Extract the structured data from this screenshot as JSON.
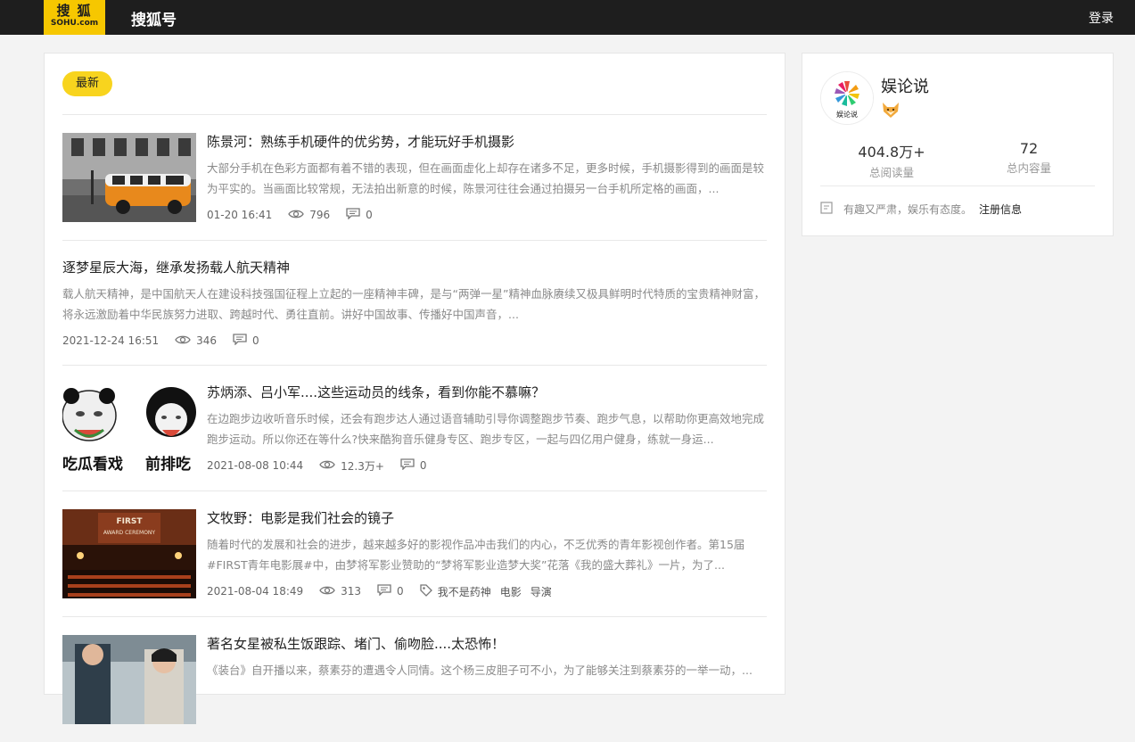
{
  "header": {
    "logo_top": "搜狐",
    "logo_bottom": "SOHU.com",
    "app_title": "搜狐号",
    "login_label": "登录"
  },
  "feed": {
    "tab_label": "最新",
    "articles": [
      {
        "title": "陈景河：熟练手机硬件的优劣势，才能玩好手机摄影",
        "summary": "大部分手机在色彩方面都有着不错的表现，但在画面虚化上却存在诸多不足，更多时候，手机摄影得到的画面是较为平实的。当画面比较常规，无法拍出新意的时候，陈景河往往会通过拍摄另一台手机所定格的画面，...",
        "time": "01-20 16:41",
        "views": "796",
        "comments": "0",
        "tags": []
      },
      {
        "title": "逐梦星辰大海，继承发扬载人航天精神",
        "summary": "载人航天精神，是中国航天人在建设科技强国征程上立起的一座精神丰碑，是与“两弹一星”精神血脉赓续又极具鲜明时代特质的宝贵精神财富，将永远激励着中华民族努力进取、跨越时代、勇往直前。讲好中国故事、传播好中国声音，...",
        "time": "2021-12-24 16:51",
        "views": "346",
        "comments": "0",
        "tags": []
      },
      {
        "title": "苏炳添、吕小军....这些运动员的线条，看到你能不慕嘛？",
        "summary": "在边跑步边收听音乐时候，还会有跑步达人通过语音辅助引导你调整跑步节奏、跑步气息，以帮助你更高效地完成跑步运动。所以你还在等什么?快来酷狗音乐健身专区、跑步专区，一起与四亿用户健身，练就一身运...",
        "time": "2021-08-08 10:44",
        "views": "12.3万+",
        "comments": "0",
        "tags": [],
        "thumb_captions": [
          "吃瓜看戏",
          "前排吃"
        ]
      },
      {
        "title": "文牧野：电影是我们社会的镜子",
        "summary": "随着时代的发展和社会的进步，越来越多好的影视作品冲击我们的内心，不乏优秀的青年影视创作者。第15届#FIRST青年电影展#中，由梦将军影业赞助的“梦将军影业造梦大奖”花落《我的盛大葬礼》一片，为了...",
        "time": "2021-08-04 18:49",
        "views": "313",
        "comments": "0",
        "tags": [
          "我不是药神",
          "电影",
          "导演"
        ],
        "thumb_captions": [
          "FIRST",
          "AWARD CEREMONY"
        ]
      },
      {
        "title": "著名女星被私生饭跟踪、堵门、偷吻脸....太恐怖！",
        "summary": "《装台》自开播以来，蔡素芬的遭遇令人同情。这个杨三皮胆子可不小，为了能够关注到蔡素芬的一举一动，...",
        "time": "",
        "views": "",
        "comments": "",
        "tags": []
      }
    ]
  },
  "author": {
    "name": "娱论说",
    "avatar_text": "娱论说",
    "stats": [
      {
        "value": "404.8万+",
        "label": "总阅读量"
      },
      {
        "value": "72",
        "label": "总内容量"
      }
    ],
    "slogan": "有趣又严肃，娱乐有态度。",
    "register_info_label": "注册信息"
  },
  "colors": {
    "brand_yellow": "#f6c700",
    "tab_yellow": "#f8d41e",
    "topbar": "#1e1e1e"
  }
}
